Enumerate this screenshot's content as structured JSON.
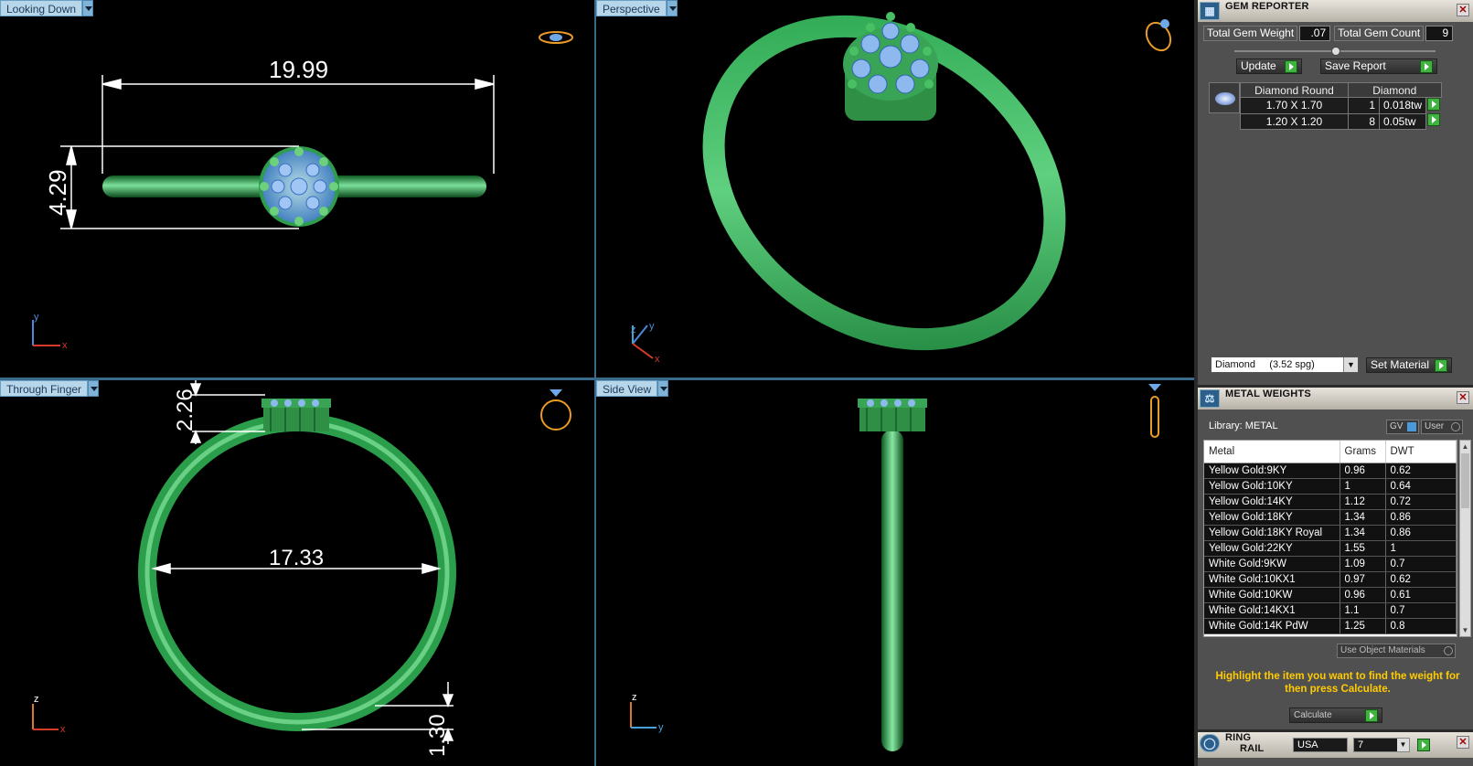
{
  "viewports": {
    "top_left": {
      "label": "Looking Down",
      "dim_width": "19.99",
      "dim_height": "4.29",
      "axis_v": "y",
      "axis_h": "x"
    },
    "top_right": {
      "label": "Perspective",
      "axis_v": "y",
      "axis_d": "z",
      "axis_h": "x"
    },
    "bottom_left": {
      "label": "Through Finger",
      "dim_top": "2.26",
      "dim_inner": "17.33",
      "dim_bottom": "1.30",
      "axis_v": "z",
      "axis_h": "x"
    },
    "bottom_right": {
      "label": "Side View",
      "axis_v": "z",
      "axis_h": "y"
    }
  },
  "gem_reporter": {
    "title": "GEM REPORTER",
    "total_weight_label": "Total Gem Weight",
    "total_weight": ".07",
    "total_count_label": "Total Gem Count",
    "total_count": "9",
    "update_label": "Update",
    "save_label": "Save Report",
    "table_header": [
      "Diamond Round",
      "Diamond"
    ],
    "rows": [
      {
        "size": "1.70 X 1.70",
        "count": "1",
        "weight": "0.018tw"
      },
      {
        "size": "1.20 X 1.20",
        "count": "8",
        "weight": "0.05tw"
      }
    ],
    "material_select": "Diamond     (3.52 spg)",
    "set_material_label": "Set Material"
  },
  "metal_weights": {
    "title": "METAL WEIGHTS",
    "library_label": "Library: METAL",
    "gv_label": "GV",
    "user_label": "User",
    "columns": [
      "Metal",
      "Grams",
      "DWT"
    ],
    "rows": [
      [
        "Yellow Gold:9KY",
        "0.96",
        "0.62"
      ],
      [
        "Yellow Gold:10KY",
        "1",
        "0.64"
      ],
      [
        "Yellow Gold:14KY",
        "1.12",
        "0.72"
      ],
      [
        "Yellow Gold:18KY",
        "1.34",
        "0.86"
      ],
      [
        "Yellow Gold:18KY Royal",
        "1.34",
        "0.86"
      ],
      [
        "Yellow Gold:22KY",
        "1.55",
        "1"
      ],
      [
        "White Gold:9KW",
        "1.09",
        "0.7"
      ],
      [
        "White Gold:10KX1",
        "0.97",
        "0.62"
      ],
      [
        "White Gold:10KW",
        "0.96",
        "0.61"
      ],
      [
        "White Gold:14KX1",
        "1.1",
        "0.7"
      ],
      [
        "White Gold:14K PdW",
        "1.25",
        "0.8"
      ]
    ],
    "use_object_label": "Use Object Materials",
    "hint": "Highlight the item you want to find the weight for then press Calculate.",
    "calculate_label": "Calculate"
  },
  "ring_rail": {
    "title_1": "RING",
    "title_2": "RAIL",
    "country": "USA",
    "size": "7"
  }
}
